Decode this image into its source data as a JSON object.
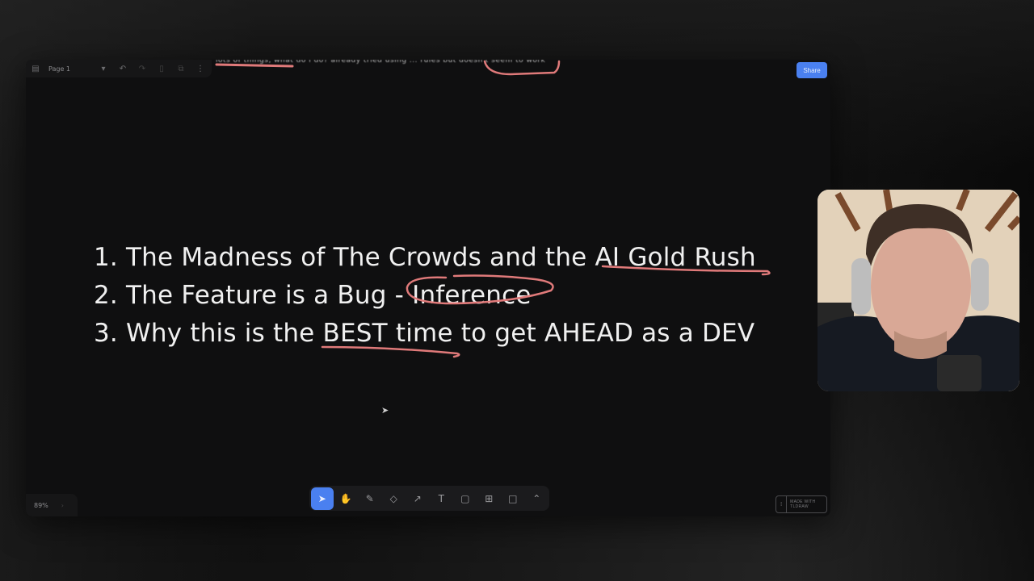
{
  "app": {
    "page_name": "Page 1",
    "share_label": "Share",
    "zoom_level": "89%",
    "made_with_label": "MADE WITH TLDRAW",
    "accent_color": "#4a80f0",
    "annotation_color": "#e07a7a"
  },
  "topbar": {
    "icons": [
      "menu-icon",
      "chevron-down-icon",
      "undo-icon",
      "redo-icon",
      "trash-icon",
      "duplicate-icon",
      "more-vertical-icon"
    ]
  },
  "canvas": {
    "cut_off_text": "lots of things, what do i do? already tried using ... rules but doesn't seem to work",
    "list_items": [
      {
        "number": "1.",
        "text_before": "The Madness of The Crowds and the ",
        "highlight": "AI Gold Rush",
        "text_after": ""
      },
      {
        "number": "2.",
        "text_before": "The Feature is a Bug - ",
        "highlight": "Inference",
        "text_after": ""
      },
      {
        "number": "3.",
        "text_before": "Why this is the ",
        "highlight": "BEST time",
        "text_after": " to get AHEAD as a DEV"
      }
    ]
  },
  "toolbar": {
    "tools": [
      {
        "name": "select",
        "glyph": "➤",
        "active": true
      },
      {
        "name": "hand",
        "glyph": "✋",
        "active": false
      },
      {
        "name": "draw",
        "glyph": "✎",
        "active": false
      },
      {
        "name": "eraser",
        "glyph": "◇",
        "active": false
      },
      {
        "name": "arrow",
        "glyph": "↗",
        "active": false
      },
      {
        "name": "text",
        "glyph": "T",
        "active": false
      },
      {
        "name": "note",
        "glyph": "▢",
        "active": false
      },
      {
        "name": "asset",
        "glyph": "⊞",
        "active": false
      },
      {
        "name": "rectangle",
        "glyph": "□",
        "active": false
      },
      {
        "name": "more",
        "glyph": "⌃",
        "active": false
      }
    ]
  },
  "webcam": {
    "description": "presenter webcam feed"
  }
}
